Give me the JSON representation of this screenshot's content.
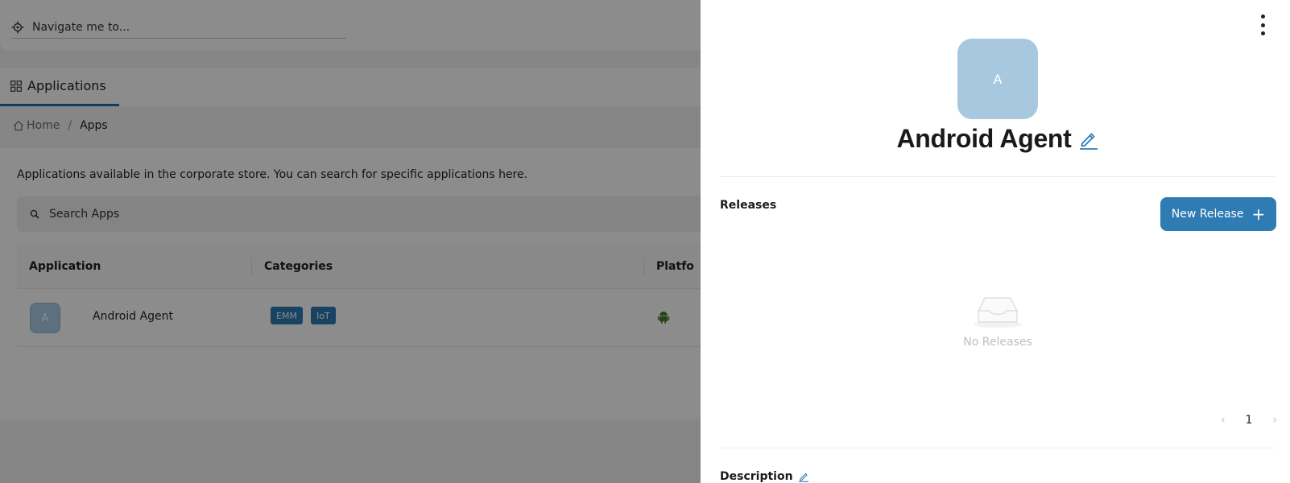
{
  "app": {
    "navigate_placeholder": "Navigate me to...",
    "tab_label": "Applications"
  },
  "breadcrumb": {
    "home": "Home",
    "separator": "/",
    "current": "Apps"
  },
  "main": {
    "description": "Applications available in the corporate store. You can search for specific applications here.",
    "search_placeholder": "Search Apps",
    "table": {
      "headers": [
        "Application",
        "Categories",
        "Platform"
      ],
      "header_visible": [
        "Application",
        "Categories",
        "Platfo"
      ],
      "rows": [
        {
          "avatar_letter": "A",
          "name": "Android Agent",
          "categories": [
            "EMM",
            "IoT"
          ],
          "platform_icon": "android-icon"
        }
      ]
    }
  },
  "drawer": {
    "avatar_letter": "A",
    "title": "Android Agent",
    "releases_label": "Releases",
    "new_release_label": "New Release",
    "empty_text": "No Releases",
    "current_page": "1",
    "description_label": "Description"
  },
  "colors": {
    "accent": "#2f7bb4",
    "avatar_bg": "#a7c8df",
    "android_green": "#4a7a2c"
  }
}
